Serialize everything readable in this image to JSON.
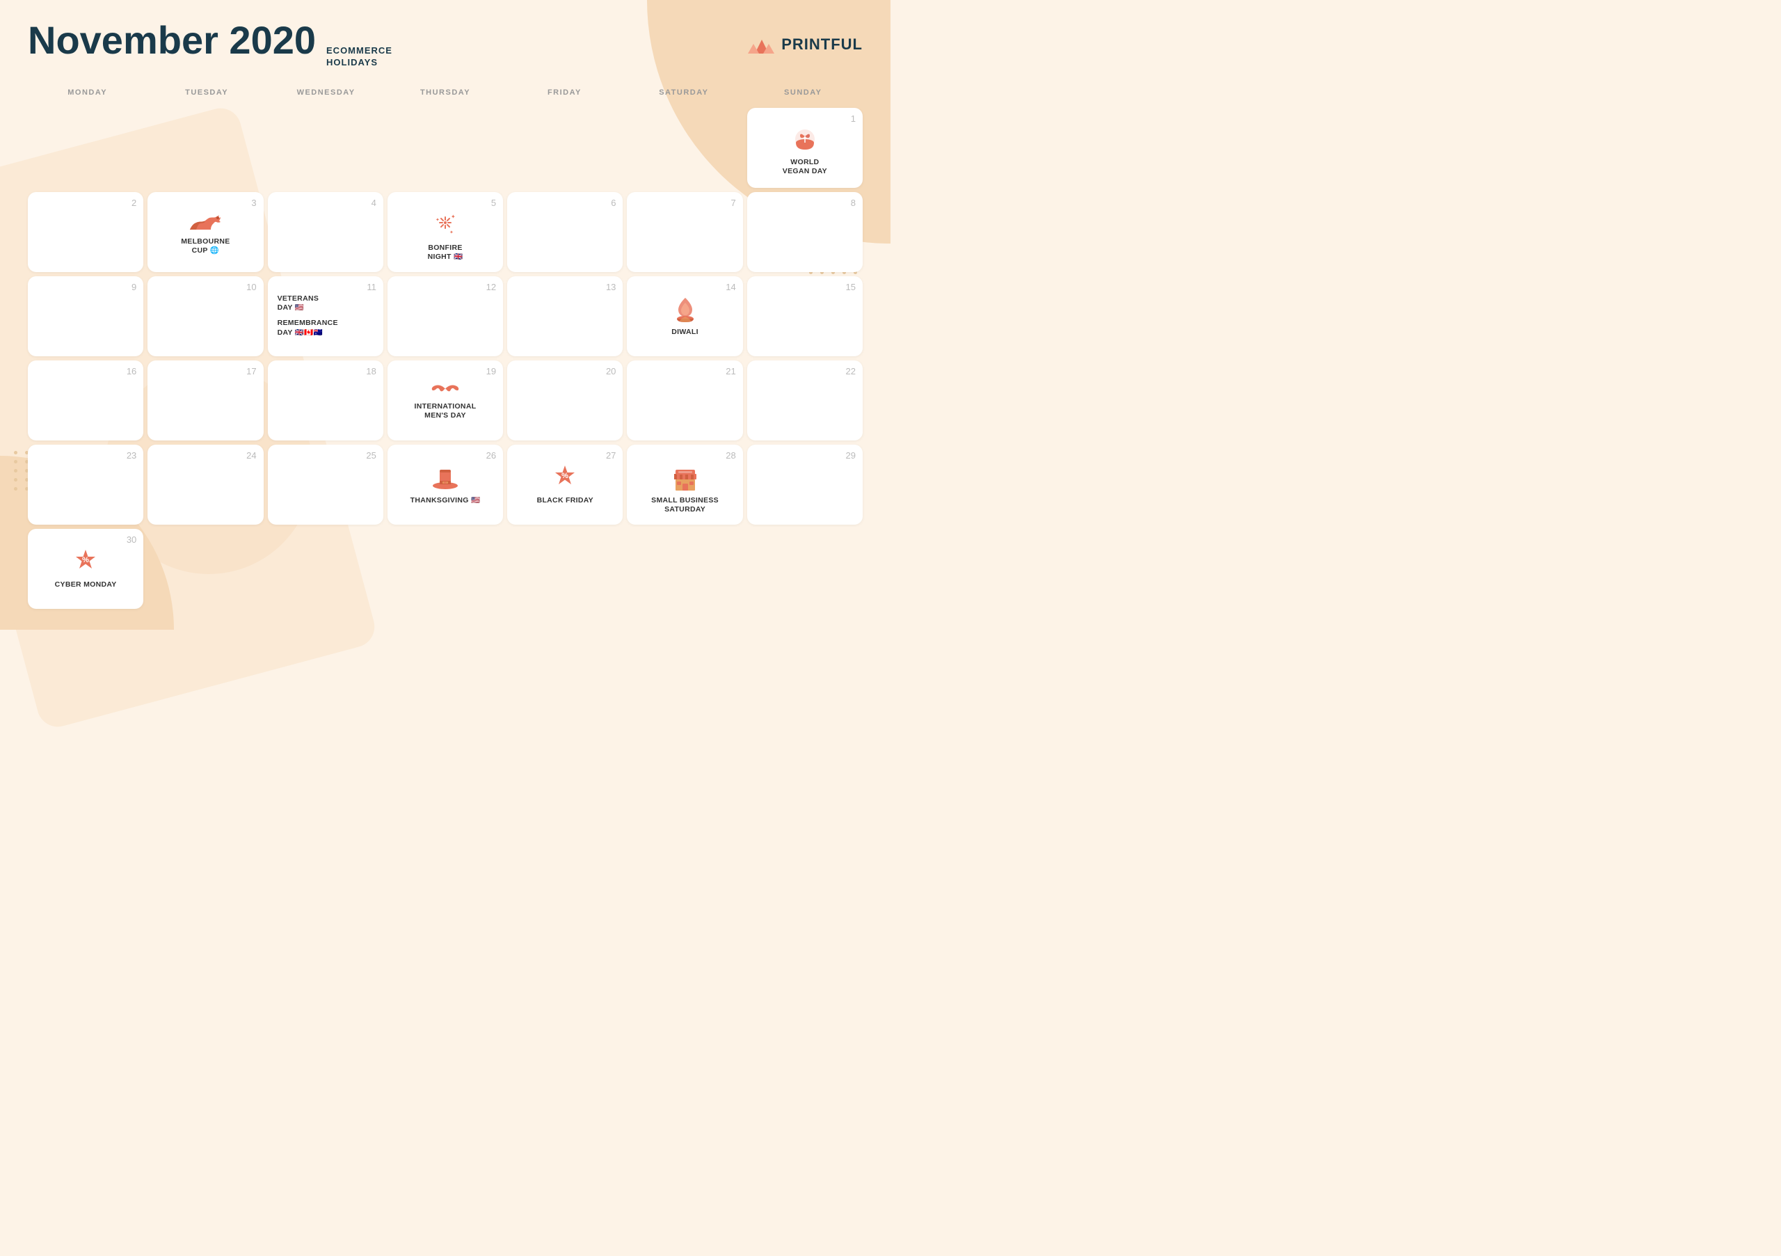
{
  "header": {
    "title": "November 2020",
    "subtitle_line1": "ECOMMERCE",
    "subtitle_line2": "HOLIDAYS",
    "logo_text": "PRINTFUL"
  },
  "days": [
    "MONDAY",
    "TUESDAY",
    "WEDNESDAY",
    "THURSDAY",
    "FRIDAY",
    "SATURDAY",
    "SUNDAY"
  ],
  "cells": [
    {
      "date": null,
      "event": null
    },
    {
      "date": null,
      "event": null
    },
    {
      "date": null,
      "event": null
    },
    {
      "date": null,
      "event": null
    },
    {
      "date": null,
      "event": null
    },
    {
      "date": null,
      "event": null
    },
    {
      "date": 1,
      "event": {
        "name": "WORLD VEGAN DAY",
        "icon": "vegan"
      }
    },
    {
      "date": 2,
      "event": null
    },
    {
      "date": 3,
      "event": {
        "name": "MELBOURNE CUP 🌐",
        "icon": "horse"
      }
    },
    {
      "date": 4,
      "event": null
    },
    {
      "date": 5,
      "event": {
        "name": "BONFIRE NIGHT 🇬🇧",
        "icon": "fireworks"
      }
    },
    {
      "date": 6,
      "event": null
    },
    {
      "date": 7,
      "event": null
    },
    {
      "date": 8,
      "event": null
    },
    {
      "date": 9,
      "event": null
    },
    {
      "date": 10,
      "event": null
    },
    {
      "date": 11,
      "event": {
        "name_multi": [
          "VETERANS DAY 🇺🇸",
          "REMEMBRANCE DAY 🇬🇧🇨🇦🇦🇺"
        ],
        "icon": null
      }
    },
    {
      "date": 12,
      "event": null
    },
    {
      "date": 13,
      "event": null
    },
    {
      "date": 14,
      "event": {
        "name": "DIWALI",
        "icon": "diwali"
      }
    },
    {
      "date": 15,
      "event": null
    },
    {
      "date": 16,
      "event": null
    },
    {
      "date": 17,
      "event": null
    },
    {
      "date": 18,
      "event": null
    },
    {
      "date": 19,
      "event": {
        "name": "INTERNATIONAL MEN'S DAY",
        "icon": "mustache"
      }
    },
    {
      "date": 20,
      "event": null
    },
    {
      "date": 21,
      "event": null
    },
    {
      "date": 22,
      "event": null
    },
    {
      "date": 23,
      "event": null
    },
    {
      "date": 24,
      "event": null
    },
    {
      "date": 25,
      "event": null
    },
    {
      "date": 26,
      "event": {
        "name": "THANKSGIVING 🇺🇸",
        "icon": "pilgrim"
      }
    },
    {
      "date": 27,
      "event": {
        "name": "BLACK FRIDAY",
        "icon": "percent-badge"
      }
    },
    {
      "date": 28,
      "event": {
        "name": "SMALL BUSINESS SATURDAY",
        "icon": "shop"
      }
    },
    {
      "date": 29,
      "event": null
    },
    {
      "date": 30,
      "event": {
        "name": "CYBER MONDAY",
        "icon": "percent-badge"
      }
    },
    {
      "date": null,
      "event": null
    },
    {
      "date": null,
      "event": null
    },
    {
      "date": null,
      "event": null
    },
    {
      "date": null,
      "event": null
    },
    {
      "date": null,
      "event": null
    },
    {
      "date": null,
      "event": null
    }
  ]
}
